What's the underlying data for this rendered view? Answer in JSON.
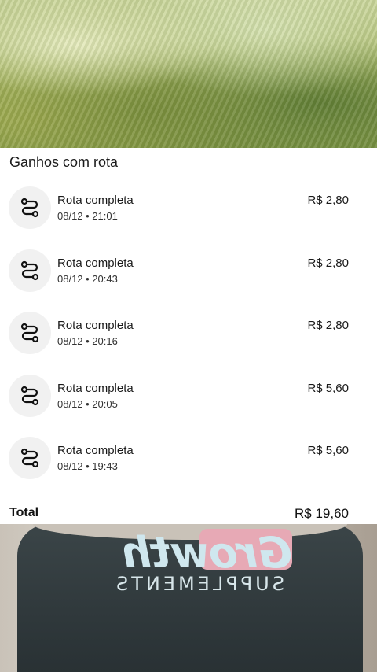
{
  "panel": {
    "title": "Ganhos com rota",
    "items": [
      {
        "label": "Rota completa",
        "meta": "08/12 • 21:01",
        "amount": "R$ 2,80",
        "icon": "route-icon"
      },
      {
        "label": "Rota completa",
        "meta": "08/12 • 20:43",
        "amount": "R$ 2,80",
        "icon": "route-icon"
      },
      {
        "label": "Rota completa",
        "meta": "08/12 • 20:16",
        "amount": "R$ 2,80",
        "icon": "route-icon"
      },
      {
        "label": "Rota completa",
        "meta": "08/12 • 20:05",
        "amount": "R$ 5,60",
        "icon": "route-icon"
      },
      {
        "label": "Rota completa",
        "meta": "08/12 • 19:43",
        "amount": "R$ 5,60",
        "icon": "route-icon"
      }
    ],
    "total": {
      "label": "Total",
      "value": "R$ 19,60"
    }
  },
  "photo_bottom": {
    "shirt_logo": "Growth",
    "shirt_tagline": "SUPPLEMENTS"
  }
}
